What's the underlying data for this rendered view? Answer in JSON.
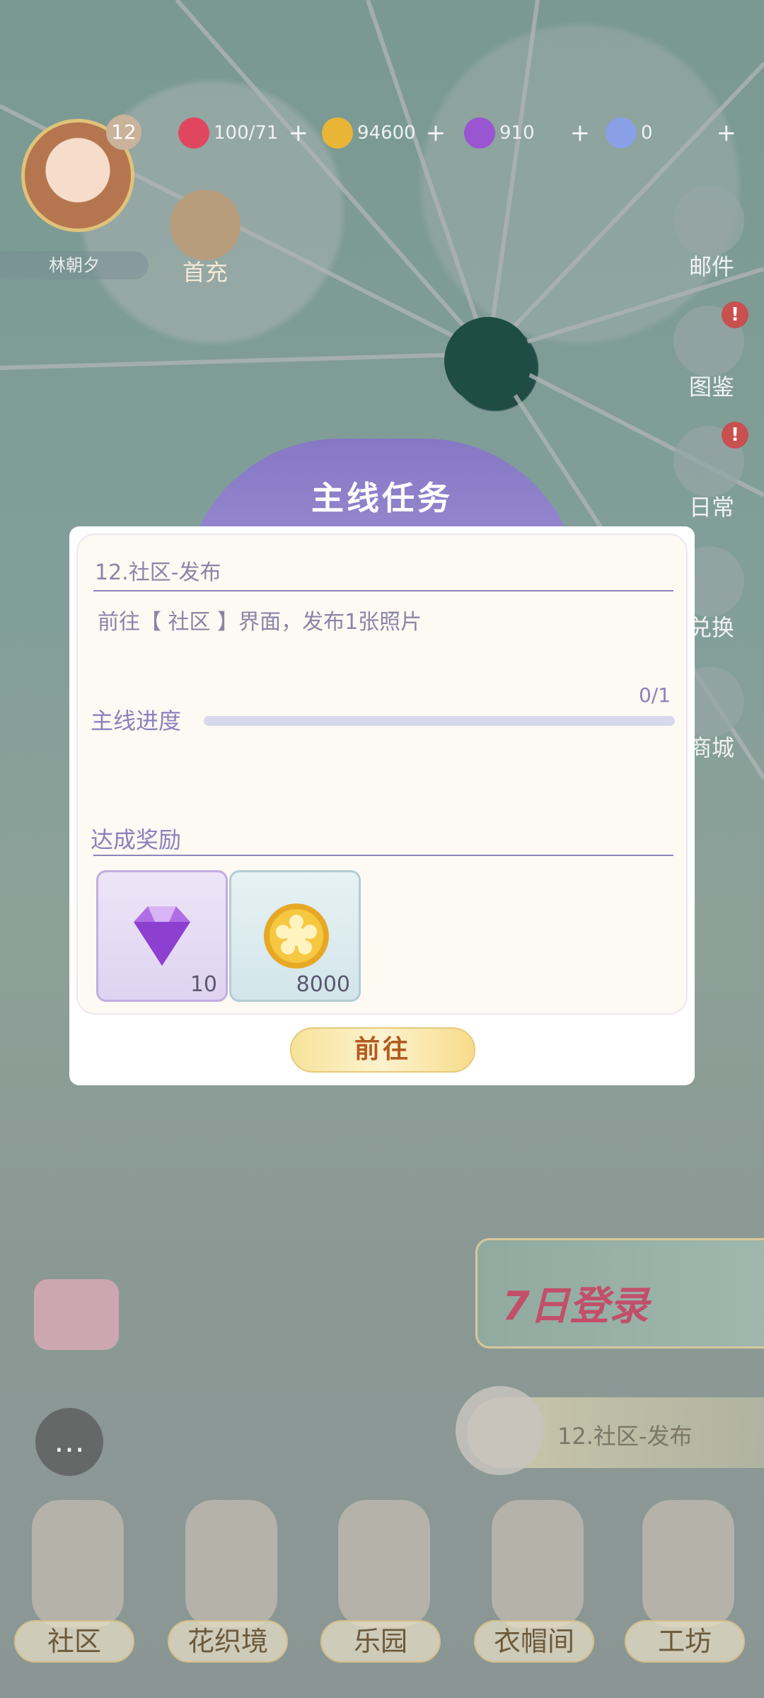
{
  "player": {
    "level": "12",
    "name": "林朝夕"
  },
  "resources": [
    {
      "icon": "heart-icon",
      "value": "100/71",
      "color": "#e0475f"
    },
    {
      "icon": "coin-icon",
      "value": "94600",
      "color": "#e8b536"
    },
    {
      "icon": "diamond-icon",
      "value": "910",
      "color": "#9a55d0"
    },
    {
      "icon": "star-icon",
      "value": "0",
      "color": "#8aa0e6"
    }
  ],
  "first_charge_label": "首充",
  "side_menu": {
    "mail": "邮件",
    "album": "图鉴",
    "daily": "日常",
    "exchange": "兑换",
    "shop": "商城",
    "alert_mark": "!"
  },
  "modal": {
    "title": "主线任务",
    "task_name": "12.社区-发布",
    "task_desc": "前往【 社区 】界面，发布1张照片",
    "progress_label": "主线进度",
    "progress_text": "0/1",
    "progress_value": 0,
    "reward_label": "达成奖励",
    "rewards": [
      {
        "icon": "diamond-icon",
        "qty": "10"
      },
      {
        "icon": "gold-coin-icon",
        "qty": "8000"
      }
    ],
    "go_button": "前往"
  },
  "login_banner": "7日登录",
  "quest_tracker": "12.社区-发布",
  "bottom_nav": [
    "社区",
    "花织境",
    "乐园",
    "衣帽间",
    "工坊"
  ]
}
